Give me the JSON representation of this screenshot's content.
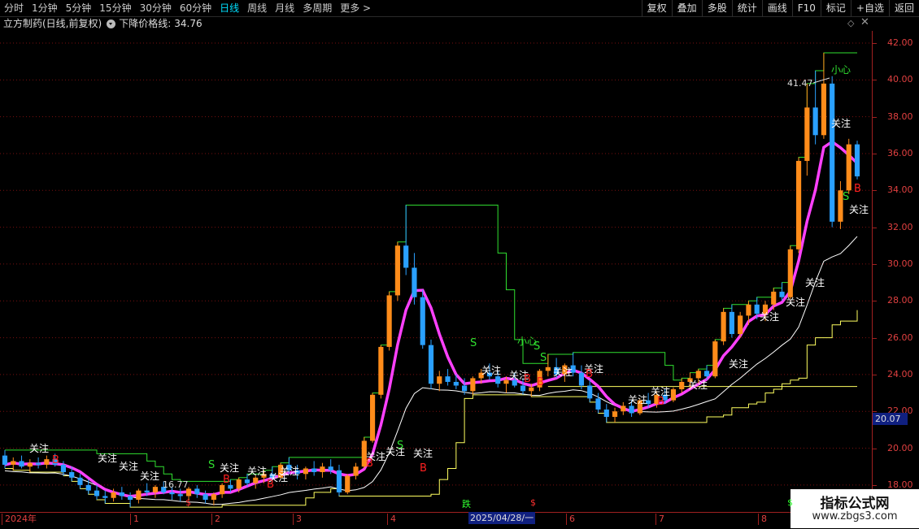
{
  "toolbar": {
    "periods": [
      "分时",
      "1分钟",
      "5分钟",
      "15分钟",
      "30分钟",
      "60分钟",
      "日线",
      "周线",
      "月线",
      "多周期",
      "更多 >"
    ],
    "active_period": "日线",
    "tools": [
      "复权",
      "叠加",
      "多股",
      "统计",
      "画线",
      "F10",
      "标记",
      "+自选",
      "返回"
    ]
  },
  "info": {
    "stock_title": "立方制药(日线,前复权)",
    "indicator_label": "下降价格线:",
    "indicator_value": "34.76"
  },
  "price_axis": {
    "ticks": [
      "42.00",
      "40.00",
      "38.00",
      "36.00",
      "34.00",
      "32.00",
      "30.00",
      "28.00",
      "26.00",
      "24.00",
      "22.00",
      "20.00",
      "18.00"
    ],
    "current_price": "20.07"
  },
  "date_axis": {
    "labels": [
      "2024年",
      "1",
      "2",
      "3",
      "4",
      "6",
      "7",
      "8"
    ],
    "cursor_date": "2025/04/28/一",
    "markers": [
      {
        "text": "$",
        "color": "#ff3030"
      },
      {
        "text": "跌",
        "color": "#30ff30"
      },
      {
        "text": "$",
        "color": "#ff3030"
      },
      {
        "text": "$",
        "color": "#30ff30"
      }
    ]
  },
  "annotations": {
    "high_value": "41.47",
    "low_value": "16.77",
    "caution": "小心",
    "watch": "关注",
    "buy": "B",
    "sell": "S"
  },
  "chart_data": {
    "type": "candlestick",
    "title": "",
    "ylim": [
      16,
      43
    ],
    "grid": true,
    "colors": {
      "up": "#ff8c1a",
      "down": "#2aa0ff",
      "ma": "#ff40ff",
      "support": "#ffffff",
      "channel": "#30e030",
      "level": "#ffff60"
    },
    "level_line": 23.35,
    "candles": [
      {
        "o": 19.6,
        "h": 19.9,
        "l": 18.9,
        "c": 19.1
      },
      {
        "o": 19.1,
        "h": 19.5,
        "l": 18.8,
        "c": 19.3
      },
      {
        "o": 19.3,
        "h": 19.6,
        "l": 18.9,
        "c": 19.0
      },
      {
        "o": 19.0,
        "h": 19.4,
        "l": 18.7,
        "c": 19.2
      },
      {
        "o": 19.2,
        "h": 19.5,
        "l": 18.9,
        "c": 19.1
      },
      {
        "o": 19.1,
        "h": 19.6,
        "l": 18.9,
        "c": 19.4
      },
      {
        "o": 19.4,
        "h": 19.7,
        "l": 19.0,
        "c": 19.1
      },
      {
        "o": 19.1,
        "h": 19.3,
        "l": 18.5,
        "c": 18.7
      },
      {
        "o": 18.7,
        "h": 19.0,
        "l": 18.2,
        "c": 18.4
      },
      {
        "o": 18.4,
        "h": 18.6,
        "l": 17.8,
        "c": 18.0
      },
      {
        "o": 18.0,
        "h": 18.3,
        "l": 17.5,
        "c": 17.7
      },
      {
        "o": 17.7,
        "h": 18.0,
        "l": 17.2,
        "c": 17.4
      },
      {
        "o": 17.4,
        "h": 17.7,
        "l": 17.0,
        "c": 17.3
      },
      {
        "o": 17.3,
        "h": 17.8,
        "l": 17.1,
        "c": 17.6
      },
      {
        "o": 17.6,
        "h": 17.9,
        "l": 17.2,
        "c": 17.4
      },
      {
        "o": 17.4,
        "h": 17.6,
        "l": 16.8,
        "c": 17.2
      },
      {
        "o": 17.2,
        "h": 17.8,
        "l": 17.0,
        "c": 17.7
      },
      {
        "o": 17.7,
        "h": 18.1,
        "l": 17.4,
        "c": 17.6
      },
      {
        "o": 17.6,
        "h": 18.0,
        "l": 17.3,
        "c": 17.9
      },
      {
        "o": 17.9,
        "h": 18.2,
        "l": 17.5,
        "c": 17.6
      },
      {
        "o": 17.6,
        "h": 17.9,
        "l": 17.2,
        "c": 17.5
      },
      {
        "o": 17.5,
        "h": 17.8,
        "l": 17.1,
        "c": 17.4
      },
      {
        "o": 17.4,
        "h": 17.9,
        "l": 17.2,
        "c": 17.8
      },
      {
        "o": 17.8,
        "h": 18.0,
        "l": 17.3,
        "c": 17.5
      },
      {
        "o": 17.5,
        "h": 17.7,
        "l": 17.0,
        "c": 17.2
      },
      {
        "o": 17.2,
        "h": 17.6,
        "l": 16.9,
        "c": 17.5
      },
      {
        "o": 17.5,
        "h": 18.1,
        "l": 17.3,
        "c": 18.0
      },
      {
        "o": 18.0,
        "h": 18.3,
        "l": 17.6,
        "c": 17.8
      },
      {
        "o": 17.8,
        "h": 18.4,
        "l": 17.6,
        "c": 18.3
      },
      {
        "o": 18.3,
        "h": 18.6,
        "l": 17.9,
        "c": 18.1
      },
      {
        "o": 18.1,
        "h": 18.5,
        "l": 17.8,
        "c": 18.4
      },
      {
        "o": 18.4,
        "h": 18.8,
        "l": 18.1,
        "c": 18.6
      },
      {
        "o": 18.6,
        "h": 19.0,
        "l": 18.2,
        "c": 18.4
      },
      {
        "o": 18.4,
        "h": 19.2,
        "l": 18.3,
        "c": 19.1
      },
      {
        "o": 19.1,
        "h": 19.5,
        "l": 18.6,
        "c": 18.8
      },
      {
        "o": 18.8,
        "h": 19.1,
        "l": 18.3,
        "c": 18.6
      },
      {
        "o": 18.6,
        "h": 19.0,
        "l": 18.3,
        "c": 18.9
      },
      {
        "o": 18.9,
        "h": 19.3,
        "l": 18.5,
        "c": 18.7
      },
      {
        "o": 18.7,
        "h": 19.2,
        "l": 18.4,
        "c": 19.0
      },
      {
        "o": 19.0,
        "h": 19.4,
        "l": 18.6,
        "c": 18.8
      },
      {
        "o": 18.8,
        "h": 19.1,
        "l": 17.4,
        "c": 17.6
      },
      {
        "o": 17.6,
        "h": 18.6,
        "l": 17.5,
        "c": 18.5
      },
      {
        "o": 18.5,
        "h": 19.2,
        "l": 18.3,
        "c": 19.0
      },
      {
        "o": 19.0,
        "h": 20.6,
        "l": 18.9,
        "c": 20.4
      },
      {
        "o": 20.4,
        "h": 23.0,
        "l": 20.3,
        "c": 22.9
      },
      {
        "o": 22.9,
        "h": 25.6,
        "l": 22.7,
        "c": 25.5
      },
      {
        "o": 25.5,
        "h": 28.5,
        "l": 25.3,
        "c": 28.3
      },
      {
        "o": 28.3,
        "h": 31.2,
        "l": 28.0,
        "c": 31.0
      },
      {
        "o": 31.0,
        "h": 33.2,
        "l": 29.4,
        "c": 29.8
      },
      {
        "o": 29.8,
        "h": 30.6,
        "l": 27.8,
        "c": 28.2
      },
      {
        "o": 28.2,
        "h": 28.6,
        "l": 25.4,
        "c": 25.6
      },
      {
        "o": 25.6,
        "h": 25.9,
        "l": 23.2,
        "c": 23.5
      },
      {
        "o": 23.5,
        "h": 24.2,
        "l": 23.1,
        "c": 23.9
      },
      {
        "o": 23.9,
        "h": 24.3,
        "l": 23.4,
        "c": 23.6
      },
      {
        "o": 23.6,
        "h": 24.0,
        "l": 23.2,
        "c": 23.4
      },
      {
        "o": 23.4,
        "h": 23.8,
        "l": 22.9,
        "c": 23.1
      },
      {
        "o": 23.1,
        "h": 23.9,
        "l": 22.9,
        "c": 23.8
      },
      {
        "o": 23.8,
        "h": 24.3,
        "l": 23.5,
        "c": 24.1
      },
      {
        "o": 24.1,
        "h": 24.6,
        "l": 23.7,
        "c": 23.9
      },
      {
        "o": 23.9,
        "h": 24.2,
        "l": 23.3,
        "c": 23.5
      },
      {
        "o": 23.5,
        "h": 23.9,
        "l": 23.0,
        "c": 23.7
      },
      {
        "o": 23.7,
        "h": 24.1,
        "l": 23.3,
        "c": 23.4
      },
      {
        "o": 23.4,
        "h": 23.8,
        "l": 22.9,
        "c": 23.1
      },
      {
        "o": 23.1,
        "h": 23.5,
        "l": 22.8,
        "c": 23.3
      },
      {
        "o": 23.3,
        "h": 24.3,
        "l": 23.1,
        "c": 24.2
      },
      {
        "o": 24.2,
        "h": 25.1,
        "l": 23.9,
        "c": 24.4
      },
      {
        "o": 24.4,
        "h": 24.9,
        "l": 23.8,
        "c": 24.0
      },
      {
        "o": 24.0,
        "h": 24.6,
        "l": 23.6,
        "c": 24.5
      },
      {
        "o": 24.5,
        "h": 25.2,
        "l": 23.9,
        "c": 24.1
      },
      {
        "o": 24.1,
        "h": 24.5,
        "l": 23.2,
        "c": 23.4
      },
      {
        "o": 23.4,
        "h": 23.7,
        "l": 22.5,
        "c": 22.7
      },
      {
        "o": 22.7,
        "h": 23.0,
        "l": 21.9,
        "c": 22.1
      },
      {
        "o": 22.1,
        "h": 22.4,
        "l": 21.4,
        "c": 21.7
      },
      {
        "o": 21.7,
        "h": 22.2,
        "l": 21.4,
        "c": 22.0
      },
      {
        "o": 22.0,
        "h": 22.5,
        "l": 21.8,
        "c": 22.3
      },
      {
        "o": 22.3,
        "h": 22.6,
        "l": 21.7,
        "c": 21.9
      },
      {
        "o": 21.9,
        "h": 22.7,
        "l": 21.8,
        "c": 22.6
      },
      {
        "o": 22.6,
        "h": 23.0,
        "l": 22.2,
        "c": 22.4
      },
      {
        "o": 22.4,
        "h": 23.1,
        "l": 22.2,
        "c": 22.9
      },
      {
        "o": 22.9,
        "h": 23.2,
        "l": 22.4,
        "c": 22.6
      },
      {
        "o": 22.6,
        "h": 23.3,
        "l": 22.5,
        "c": 23.2
      },
      {
        "o": 23.2,
        "h": 23.8,
        "l": 23.0,
        "c": 23.6
      },
      {
        "o": 23.6,
        "h": 24.1,
        "l": 23.2,
        "c": 23.8
      },
      {
        "o": 23.8,
        "h": 24.3,
        "l": 23.5,
        "c": 24.2
      },
      {
        "o": 24.2,
        "h": 24.5,
        "l": 23.7,
        "c": 23.9
      },
      {
        "o": 23.9,
        "h": 25.9,
        "l": 23.8,
        "c": 25.8
      },
      {
        "o": 25.8,
        "h": 27.6,
        "l": 25.6,
        "c": 27.4
      },
      {
        "o": 27.4,
        "h": 27.8,
        "l": 26.0,
        "c": 26.2
      },
      {
        "o": 26.2,
        "h": 27.4,
        "l": 26.0,
        "c": 27.2
      },
      {
        "o": 27.2,
        "h": 28.0,
        "l": 26.7,
        "c": 27.8
      },
      {
        "o": 27.8,
        "h": 28.2,
        "l": 27.0,
        "c": 27.3
      },
      {
        "o": 27.3,
        "h": 28.0,
        "l": 26.9,
        "c": 27.8
      },
      {
        "o": 27.8,
        "h": 28.7,
        "l": 27.5,
        "c": 28.5
      },
      {
        "o": 28.5,
        "h": 29.0,
        "l": 28.0,
        "c": 28.2
      },
      {
        "o": 28.2,
        "h": 31.0,
        "l": 28.1,
        "c": 30.8
      },
      {
        "o": 30.8,
        "h": 35.8,
        "l": 30.6,
        "c": 35.6
      },
      {
        "o": 35.6,
        "h": 39.8,
        "l": 34.8,
        "c": 38.5
      },
      {
        "o": 38.5,
        "h": 40.5,
        "l": 36.5,
        "c": 37.0
      },
      {
        "o": 37.0,
        "h": 41.47,
        "l": 36.8,
        "c": 39.8
      },
      {
        "o": 39.8,
        "h": 40.2,
        "l": 32.0,
        "c": 32.3
      },
      {
        "o": 32.3,
        "h": 34.5,
        "l": 31.9,
        "c": 34.0
      },
      {
        "o": 34.0,
        "h": 36.8,
        "l": 33.8,
        "c": 36.5
      },
      {
        "o": 36.5,
        "h": 36.7,
        "l": 34.6,
        "c": 34.76
      }
    ],
    "x_labels": [
      "2024年",
      "1",
      "2",
      "3",
      "4",
      "6",
      "7",
      "8"
    ]
  }
}
